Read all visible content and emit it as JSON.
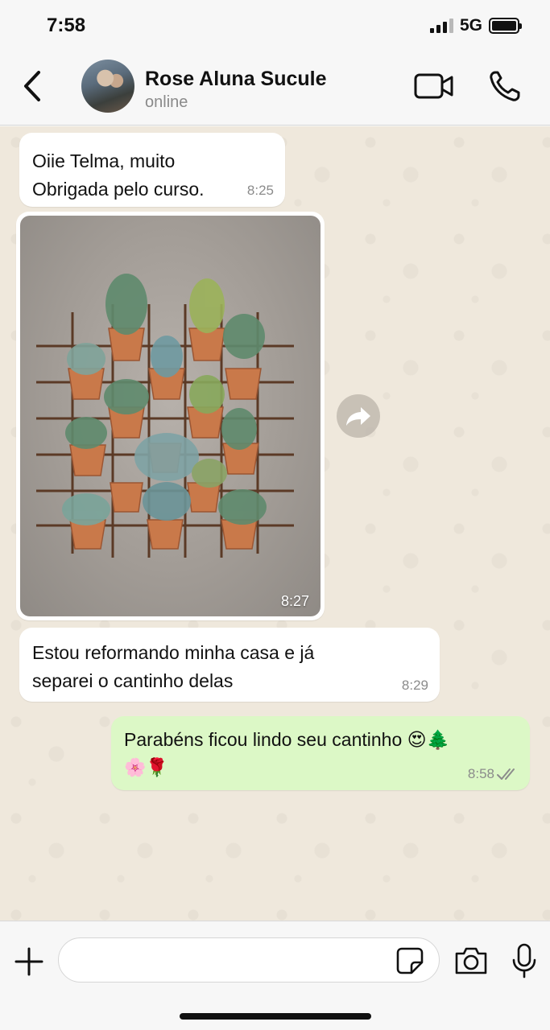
{
  "status_bar": {
    "time": "7:58",
    "network": "5G"
  },
  "header": {
    "contact_name": "Rose Aluna Sucule",
    "contact_status": "online"
  },
  "messages": [
    {
      "direction": "incoming",
      "type": "text",
      "lines": [
        "Oiie Telma, muito",
        "Obrigada pelo curso."
      ],
      "time": "8:25"
    },
    {
      "direction": "incoming",
      "type": "image",
      "time": "8:27"
    },
    {
      "direction": "incoming",
      "type": "text",
      "lines": [
        "Estou reformando minha casa e já",
        "separei o cantinho delas"
      ],
      "time": "8:29"
    },
    {
      "direction": "outgoing",
      "type": "text",
      "lines": [
        "Parabéns ficou lindo seu cantinho 😍🌲",
        "🌸🌹"
      ],
      "time": "8:58",
      "status": "read"
    }
  ],
  "composer": {
    "input_value": "",
    "input_placeholder": ""
  },
  "colors": {
    "outgoing_bubble": "#dcf8c6",
    "incoming_bubble": "#ffffff",
    "wallpaper": "#efe8dc",
    "read_ticks": "#8b8b8b"
  },
  "icons": {
    "back": "chevron-left-icon",
    "video": "video-camera-icon",
    "call": "phone-icon",
    "forward": "forward-arrow-icon",
    "add": "plus-icon",
    "sticker": "sticker-icon",
    "camera": "camera-icon",
    "mic": "microphone-icon"
  }
}
